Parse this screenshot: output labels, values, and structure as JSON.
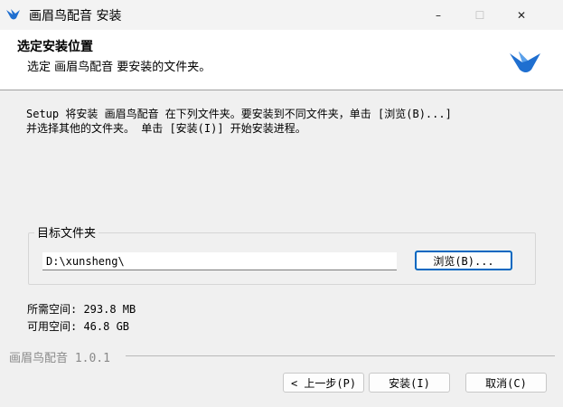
{
  "window": {
    "title": "画眉鸟配音 安装",
    "controls": {
      "minimize": "–",
      "maximize": "☐",
      "close": "✕"
    }
  },
  "header": {
    "title": "选定安装位置",
    "subtitle": "选定 画眉鸟配音 要安装的文件夹。"
  },
  "description": "Setup 将安装 画眉鸟配音 在下列文件夹。要安装到不同文件夹，单击 [浏览(B)...]\n并选择其他的文件夹。 单击 [安装(I)] 开始安装进程。",
  "destination": {
    "group_label": "目标文件夹",
    "path_value": "D:\\xunsheng\\",
    "browse_label": "浏览(B)..."
  },
  "space": {
    "required": "所需空间: 293.8 MB",
    "available": "可用空间: 46.8 GB"
  },
  "footer": {
    "brand": "画眉鸟配音 1.0.1",
    "back_label": "< 上一步(P)",
    "install_label": "安装(I)",
    "cancel_label": "取消(C)"
  },
  "colors": {
    "accent": "#0067c0",
    "logo": "#1f6fd0"
  }
}
